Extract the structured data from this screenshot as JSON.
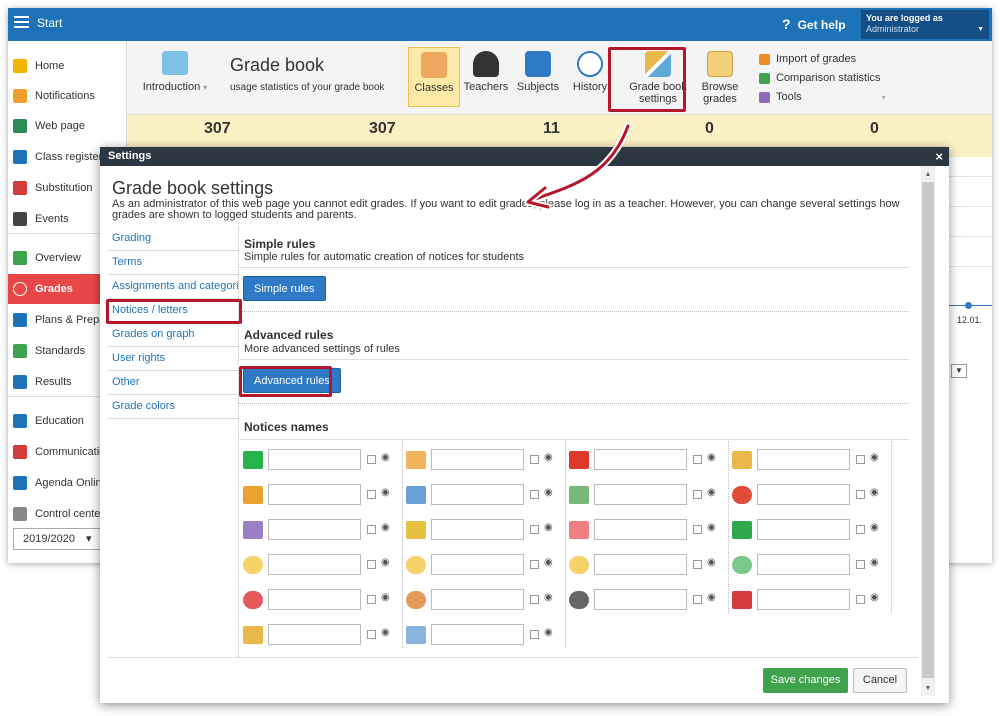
{
  "topbar": {
    "start": "Start",
    "help": "Get help",
    "help_icon": "?",
    "login_line1": "You are logged as",
    "login_line2": "Administrator"
  },
  "sidebar": {
    "items": [
      {
        "label": "Home",
        "icon": "star-icon",
        "color": "#f4b400"
      },
      {
        "label": "Notifications",
        "icon": "envelope-icon",
        "color": "#f0a030"
      },
      {
        "label": "Web page",
        "icon": "house-icon",
        "color": "#2e8b57"
      },
      {
        "label": "Class register",
        "icon": "book-icon",
        "color": "#1e73b8"
      },
      {
        "label": "Substitution",
        "icon": "person-icon",
        "color": "#d23c3c"
      },
      {
        "label": "Events",
        "icon": "calendar-icon",
        "color": "#444444"
      },
      {
        "label": "Overview",
        "icon": "check-icon",
        "color": "#3fa34d"
      },
      {
        "label": "Grades",
        "icon": "grade-icon",
        "color": "#ffffff"
      },
      {
        "label": "Plans & Preparations",
        "icon": "plans-icon",
        "color": "#1e73b8"
      },
      {
        "label": "Standards",
        "icon": "shield-icon",
        "color": "#3fa34d"
      },
      {
        "label": "Results",
        "icon": "bar-chart-icon",
        "color": "#1e73b8"
      },
      {
        "label": "Education",
        "icon": "education-icon",
        "color": "#1e73b8"
      },
      {
        "label": "Communication",
        "icon": "chat-icon",
        "color": "#d23c3c"
      },
      {
        "label": "Agenda Online",
        "icon": "pen-icon",
        "color": "#1e73b8"
      },
      {
        "label": "Control center",
        "icon": "gear-icon",
        "color": "#888888"
      }
    ],
    "year": "2019/2020"
  },
  "toolbar": {
    "intro": "Introduction",
    "title": "Grade book",
    "subtitle": "usage statistics of your grade book",
    "buttons": [
      {
        "label": "Classes"
      },
      {
        "label": "Teachers"
      },
      {
        "label": "Subjects"
      },
      {
        "label": "History"
      },
      {
        "label": "Grade book settings"
      },
      {
        "label": "Browse grades"
      }
    ],
    "tools": [
      "Import of grades",
      "Comparison statistics",
      "Tools"
    ]
  },
  "stats": [
    "307",
    "307",
    "11",
    "0",
    "0"
  ],
  "right_fragment": {
    "date": "12.01."
  },
  "dialog": {
    "header": "Settings",
    "close": "×",
    "title": "Grade book settings",
    "description": "As an administrator of this web page you cannot edit grades. If you want to edit grades, please log in as a teacher. However, you can change several settings how grades are shown to logged students and parents.",
    "menu": [
      "Grading",
      "Terms",
      "Assignments and categories",
      "Notices / letters",
      "Grades on graph",
      "User rights",
      "Other",
      "Grade colors"
    ],
    "simple_title": "Simple rules",
    "simple_sub": "Simple rules for automatic creation of notices for students",
    "simple_btn": "Simple rules",
    "advanced_title": "Advanced rules",
    "advanced_sub": "More advanced settings of rules",
    "advanced_btn": "Advanced rules",
    "notices_title": "Notices names",
    "notice_icons": [
      "green-rect-icon",
      "envelope-icon",
      "red-rect-icon",
      "medal-star-icon",
      "key-icon",
      "phone-icon",
      "shoe-icon",
      "alarm-clock-icon",
      "bag-icon",
      "bee-icon",
      "piggy-icon",
      "green-star-icon",
      "smile-icon",
      "neutral-face-icon",
      "sad-face-icon",
      "plus-circle-icon",
      "minus-circle-icon",
      "coin-icon",
      "football-icon",
      "cherry-icon",
      "medal-icon",
      "document-icon"
    ],
    "save": "Save changes",
    "cancel": "Cancel"
  }
}
